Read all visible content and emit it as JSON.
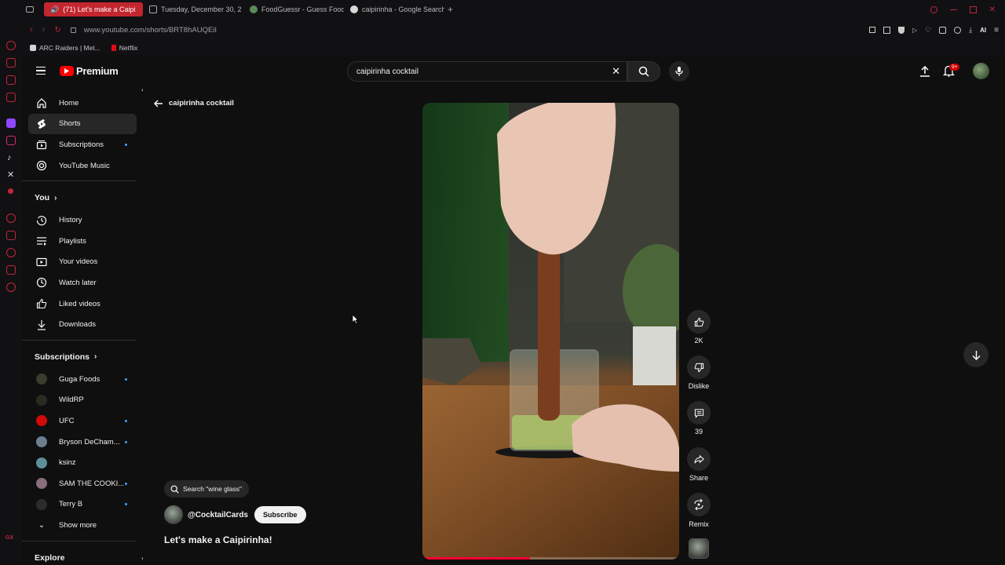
{
  "browser": {
    "tabs": [
      {
        "label": "(71) Let's make a Caipi",
        "active": true
      },
      {
        "label": "Tuesday, December 30, 2"
      },
      {
        "label": "FoodGuessr - Guess Food"
      },
      {
        "label": "caipirinha - Google Search"
      }
    ],
    "url": "www.youtube.com/shorts/BRT8hAUQEiI",
    "bookmarks": [
      "ARC Raiders | Met...",
      "Netflix"
    ],
    "ai_label": "AI"
  },
  "masthead": {
    "logo_text": "Premium",
    "search_value": "caipirinha cocktail",
    "notification_count": "9+"
  },
  "sidebar": {
    "main": [
      {
        "label": "Home",
        "icon": "home-icon"
      },
      {
        "label": "Shorts",
        "icon": "shorts-icon",
        "active": true
      },
      {
        "label": "Subscriptions",
        "icon": "subscriptions-icon",
        "dot": true
      },
      {
        "label": "YouTube Music",
        "icon": "music-icon"
      }
    ],
    "you_heading": "You",
    "you": [
      {
        "label": "History",
        "icon": "history-icon"
      },
      {
        "label": "Playlists",
        "icon": "playlists-icon"
      },
      {
        "label": "Your videos",
        "icon": "your-videos-icon"
      },
      {
        "label": "Watch later",
        "icon": "watch-later-icon"
      },
      {
        "label": "Liked videos",
        "icon": "liked-icon"
      },
      {
        "label": "Downloads",
        "icon": "downloads-icon"
      }
    ],
    "subscriptions_heading": "Subscriptions",
    "subscriptions": [
      {
        "label": "Guga Foods",
        "dot": true,
        "color": "#3b3b2e"
      },
      {
        "label": "WildRP",
        "dot": false,
        "color": "#2b2b22"
      },
      {
        "label": "UFC",
        "dot": true,
        "color": "#d20a0a"
      },
      {
        "label": "Bryson DeCham...",
        "dot": true,
        "color": "#6d7f8f"
      },
      {
        "label": "ksinz",
        "dot": false,
        "color": "#5c8f9a"
      },
      {
        "label": "SAM THE COOKI...",
        "dot": true,
        "color": "#8a6d7a"
      },
      {
        "label": "Terry B",
        "dot": true,
        "color": "#2c2c2c"
      }
    ],
    "show_more": "Show more",
    "explore_heading": "Explore"
  },
  "shorts": {
    "back_query": "caipirinha cocktail",
    "search_chip": "Search \"wine glass\"",
    "channel": "@CocktailCards",
    "subscribe": "Subscribe",
    "title": "Let's make a Caipirinha!",
    "progress": 0.42,
    "actions": {
      "likes": "2K",
      "dislike": "Dislike",
      "comments": "39",
      "share": "Share",
      "remix": "Remix"
    }
  }
}
